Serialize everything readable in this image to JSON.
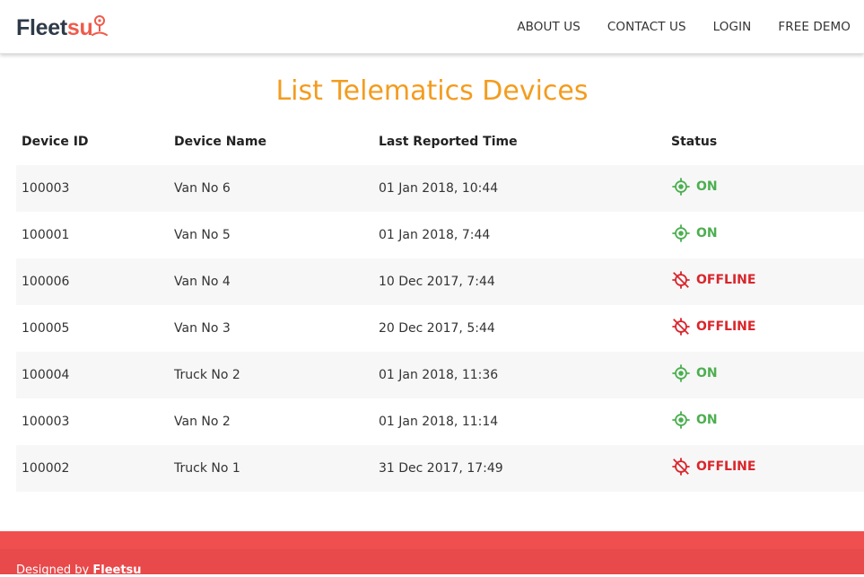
{
  "brand": {
    "logo_part1": "Fleet",
    "logo_part2": "su"
  },
  "nav": {
    "items": [
      {
        "label": "ABOUT US"
      },
      {
        "label": "CONTACT US"
      },
      {
        "label": "LOGIN"
      },
      {
        "label": "FREE DEMO"
      }
    ]
  },
  "page": {
    "title": "List Telematics Devices"
  },
  "table": {
    "columns": [
      "Device ID",
      "Device Name",
      "Last Reported Time",
      "Status"
    ],
    "rows": [
      {
        "device_id": "100003",
        "device_name": "Van No 6",
        "last_reported": "01 Jan 2018, 10:44",
        "status": "ON"
      },
      {
        "device_id": "100001",
        "device_name": "Van No 5",
        "last_reported": "01 Jan 2018, 7:44",
        "status": "ON"
      },
      {
        "device_id": "100006",
        "device_name": "Van No 4",
        "last_reported": "10 Dec 2017, 7:44",
        "status": "OFFLINE"
      },
      {
        "device_id": "100005",
        "device_name": "Van No 3",
        "last_reported": "20 Dec 2017, 5:44",
        "status": "OFFLINE"
      },
      {
        "device_id": "100004",
        "device_name": "Truck No 2",
        "last_reported": "01 Jan 2018, 11:36",
        "status": "ON"
      },
      {
        "device_id": "100003",
        "device_name": "Van No 2",
        "last_reported": "01 Jan 2018, 11:14",
        "status": "ON"
      },
      {
        "device_id": "100002",
        "device_name": "Truck No 1",
        "last_reported": "31 Dec 2017, 17:49",
        "status": "OFFLINE"
      }
    ]
  },
  "status_styles": {
    "ON": {
      "color": "#4caf50",
      "icon": "gps-fixed-icon"
    },
    "OFFLINE": {
      "color": "#d9262c",
      "icon": "gps-off-icon"
    }
  },
  "footer": {
    "prefix": "Designed by ",
    "brand": "Fleetsu"
  },
  "colors": {
    "accent": "#f39c1f",
    "logo_dark": "#2f3a48",
    "logo_red": "#f05a4b",
    "footer": "#f04f4f"
  }
}
